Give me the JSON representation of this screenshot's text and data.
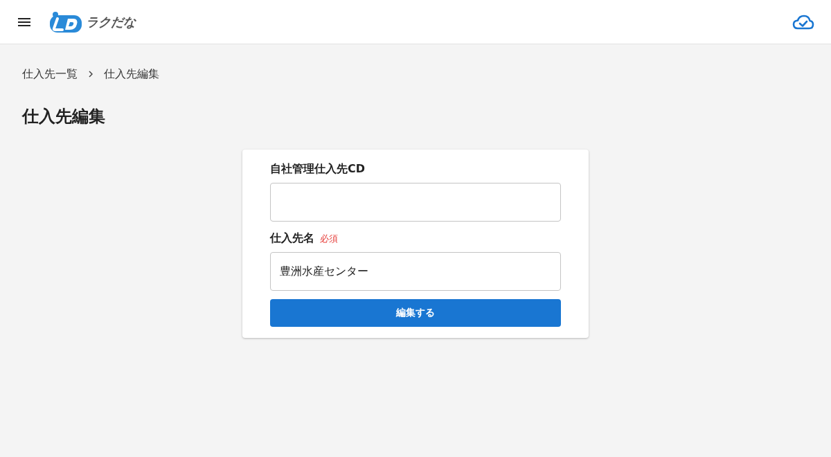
{
  "header": {
    "logo_text": "ラクだな"
  },
  "breadcrumb": [
    {
      "label": "仕入先一覧"
    },
    {
      "label": "仕入先編集"
    }
  ],
  "page_title": "仕入先編集",
  "form": {
    "fields": [
      {
        "label": "自社管理仕入先CD"
      },
      {
        "label": "仕入先名",
        "required_mark": "必須",
        "value": "豊洲水産センター"
      }
    ],
    "submit_button": {
      "label": "編集する"
    }
  }
}
